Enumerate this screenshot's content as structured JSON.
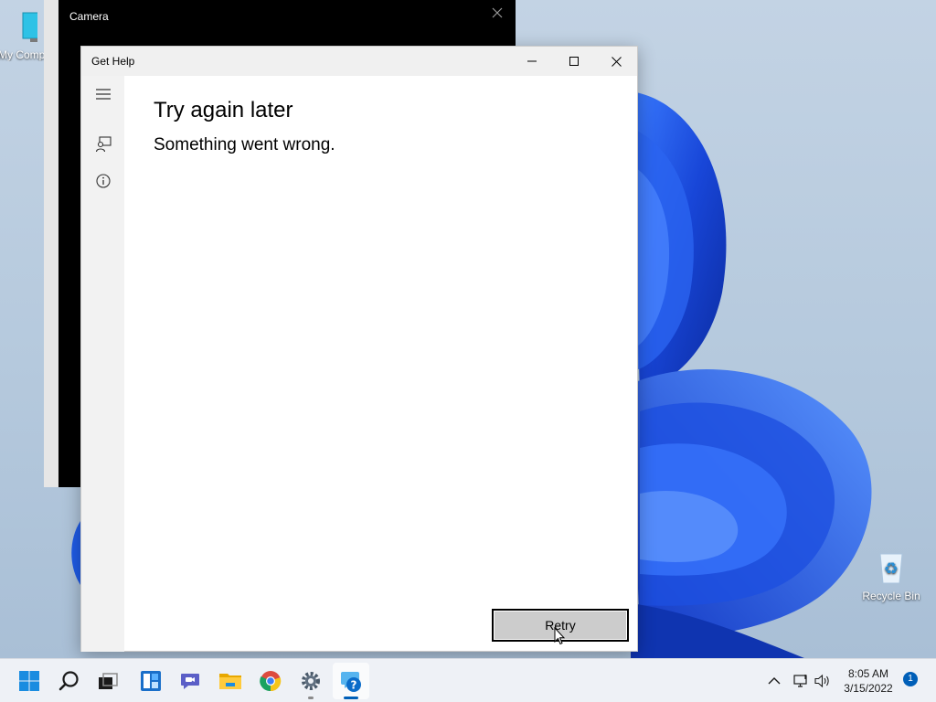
{
  "desktop": {
    "icons": [
      {
        "label": "My Computer"
      },
      {
        "label": "Recycle Bin"
      }
    ]
  },
  "camera_window": {
    "title": "Camera"
  },
  "gethelp_window": {
    "title": "Get Help",
    "heading": "Try again later",
    "message": "Something went wrong.",
    "retry_label": "Retry"
  },
  "taskbar": {
    "apps": [
      "start-icon",
      "search-icon",
      "task-view-icon",
      "widgets-icon",
      "teams-chat-icon",
      "file-explorer-icon",
      "chrome-icon",
      "settings-icon",
      "get-help-icon"
    ],
    "time": "8:05 AM",
    "date": "3/15/2022",
    "notification_count": "1"
  },
  "colors": {
    "accent": "#005fb8",
    "wallpaper_blue": "#1a4fd6"
  }
}
